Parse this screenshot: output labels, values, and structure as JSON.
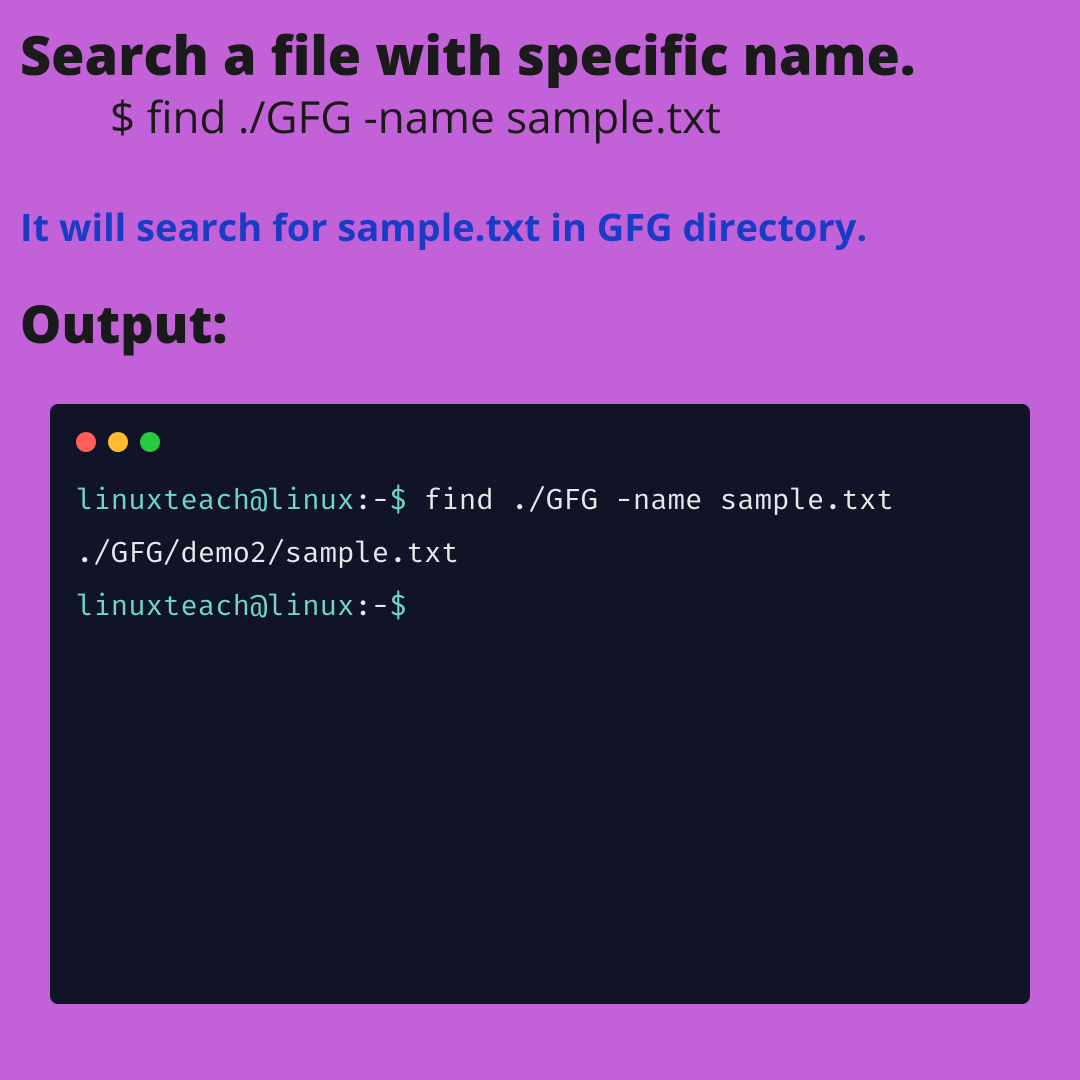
{
  "title": "Search a file with specific name.",
  "command": "$ find ./GFG -name sample.txt",
  "description": "It will search for sample.txt in GFG directory.",
  "output_label": "Output:",
  "terminal": {
    "lines": [
      {
        "user": "linuxteach@linux",
        "sep": ":-",
        "dollar": "$",
        "cmd": " find ./GFG -name sample.txt"
      },
      {
        "output": "./GFG/demo2/sample.txt"
      },
      {
        "user": "linuxteach@linux",
        "sep": ":-",
        "dollar": "$",
        "cmd": ""
      }
    ]
  }
}
